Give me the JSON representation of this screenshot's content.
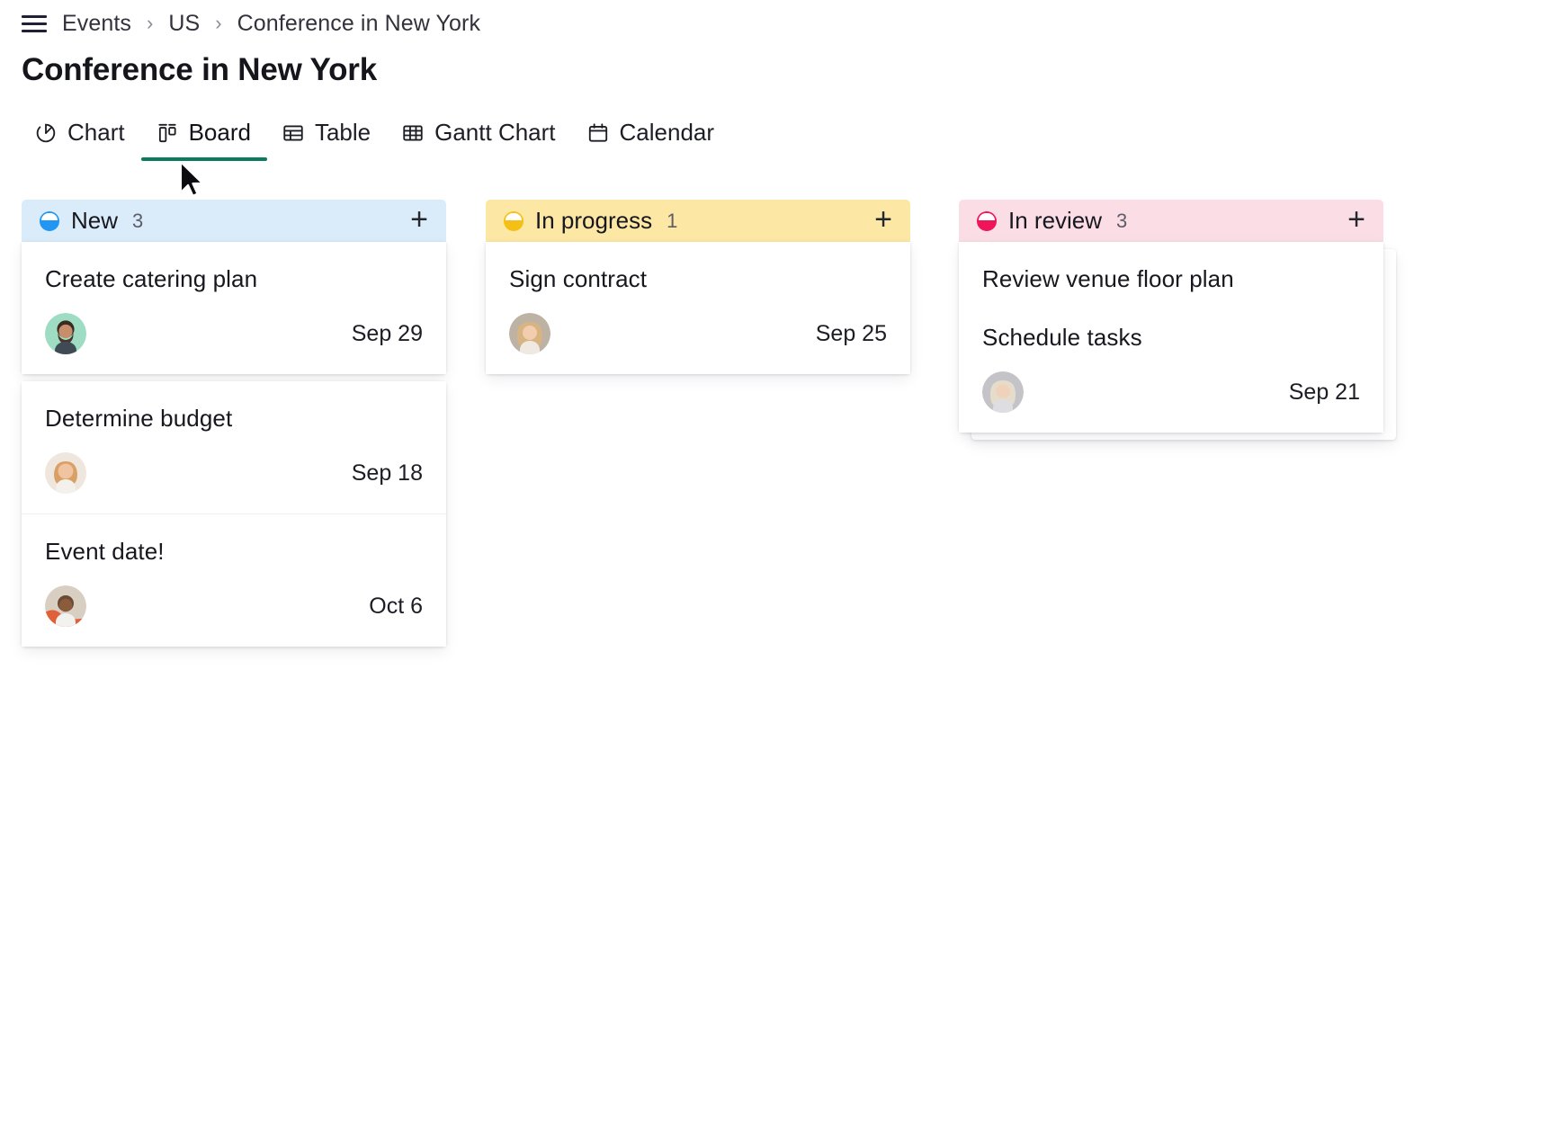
{
  "breadcrumb": {
    "menu_icon": "hamburger-menu-icon",
    "items": [
      "Events",
      "US",
      "Conference in New York"
    ],
    "separator": "›"
  },
  "page_title": "Conference in New York",
  "tabs": [
    {
      "label": "Chart",
      "icon": "pie-chart-icon",
      "active": false
    },
    {
      "label": "Board",
      "icon": "board-icon",
      "active": true
    },
    {
      "label": "Table",
      "icon": "table-icon",
      "active": false
    },
    {
      "label": "Gantt Chart",
      "icon": "gantt-icon",
      "active": false
    },
    {
      "label": "Calendar",
      "icon": "calendar-icon",
      "active": false
    }
  ],
  "active_tab_underline_color": "#0b7a5f",
  "add_button_label": "+",
  "columns": [
    {
      "name": "New",
      "count": "3",
      "header_bg": "#daecf9",
      "dot_color": "#2196f3",
      "cards": [
        {
          "title": "Create catering plan",
          "date": "Sep 29",
          "avatar": "avatar-bearded-man",
          "avatar_bg": "#9fdcc4"
        },
        {
          "title": "Determine budget",
          "date": "Sep 18",
          "avatar": "avatar-smiling-woman",
          "avatar_bg": "#f3e3d8"
        },
        {
          "title": "Event date!",
          "date": "Oct 6",
          "avatar": "avatar-man-outdoors",
          "avatar_bg": "#cbb39a"
        }
      ]
    },
    {
      "name": "In progress",
      "count": "1",
      "header_bg": "#fce8a4",
      "dot_color": "#f5c016",
      "cards": [
        {
          "title": "Sign contract",
          "date": "Sep 25",
          "avatar": "avatar-blonde-woman",
          "avatar_bg": "#cfc3b4"
        }
      ]
    },
    {
      "name": "In review",
      "count": "3",
      "header_bg": "#fbdde6",
      "dot_color": "#f0145a",
      "cards": [
        {
          "title": "Review venue floor plan",
          "date": "",
          "avatar": "",
          "avatar_bg": ""
        },
        {
          "title": "Schedule tasks",
          "date": "Sep 21",
          "avatar": "avatar-light-blonde-woman",
          "avatar_bg": "#c8c8cc"
        }
      ]
    }
  ]
}
